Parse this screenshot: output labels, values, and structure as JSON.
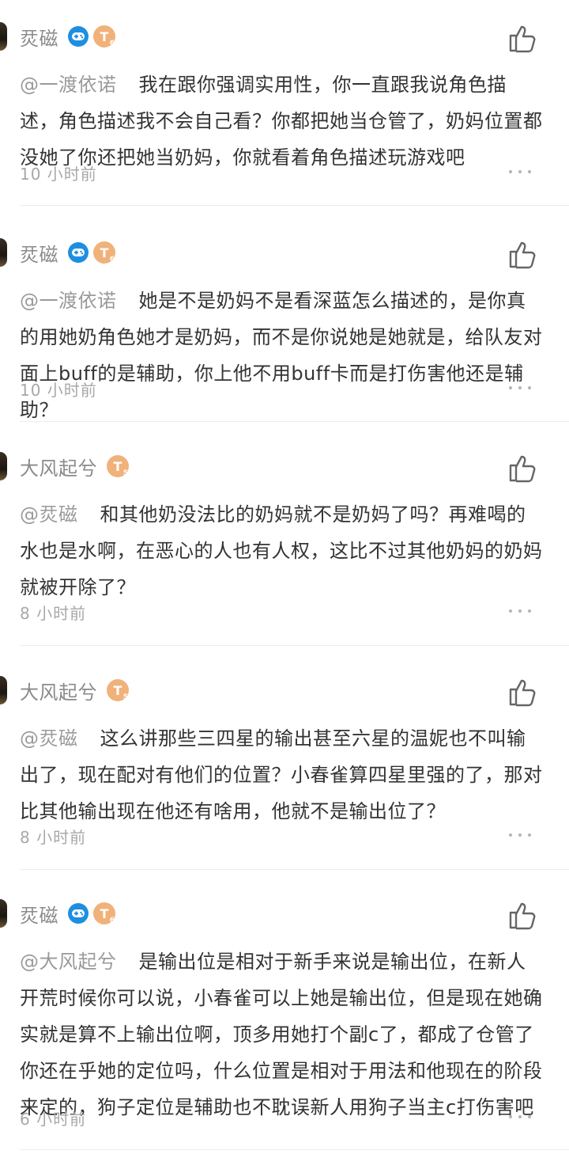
{
  "comments": [
    {
      "username": "烎磁",
      "badges": {
        "game": true,
        "level": "T",
        "level_sub": "6"
      },
      "mention": "@一渡依诺",
      "text": "我在跟你强调实用性，你一直跟我说角色描述，角色描述我不会自己看？你都把她当仓管了，奶妈位置都没她了你还把她当奶妈，你就看着角色描述玩游戏吧",
      "time": "10 小时前"
    },
    {
      "username": "烎磁",
      "badges": {
        "game": true,
        "level": "T",
        "level_sub": "6"
      },
      "mention": "@一渡依诺",
      "text": "她是不是奶妈不是看深蓝怎么描述的，是你真的用她奶角色她才是奶妈，而不是你说她是她就是，给队友对面上buff的是辅助，你上他不用buff卡而是打伤害他还是辅助？",
      "time": "10 小时前"
    },
    {
      "username": "大风起兮",
      "badges": {
        "game": false,
        "level": "T",
        "level_sub": "5"
      },
      "mention": "@烎磁",
      "text": "和其他奶没法比的奶妈就不是奶妈了吗？再难喝的水也是水啊，在恶心的人也有人权，这比不过其他奶妈的奶妈就被开除了？",
      "time": "8 小时前"
    },
    {
      "username": "大风起兮",
      "badges": {
        "game": false,
        "level": "T",
        "level_sub": "5"
      },
      "mention": "@烎磁",
      "text": "这么讲那些三四星的输出甚至六星的温妮也不叫输出了，现在配对有他们的位置？小春雀算四星里强的了，那对比其他输出现在他还有啥用，他就不是输出位了？",
      "time": "8 小时前"
    },
    {
      "username": "烎磁",
      "badges": {
        "game": true,
        "level": "T",
        "level_sub": "6"
      },
      "mention": "@大风起兮",
      "text": "是输出位是相对于新手来说是输出位，在新人开荒时候你可以说，小春雀可以上她是输出位，但是现在她确实就是算不上输出位啊，顶多用她打个副c了，都成了仓管了你还在乎她的定位吗，什么位置是相对于用法和他现在的阶段来定的，狗子定位是辅助也不耽误新人用狗子当主c打伤害吧",
      "time": "6 小时前"
    }
  ],
  "colors": {
    "game_badge": "#1e8fe0",
    "level_badge": "#f0b27a",
    "muted_text": "#8a8a8a"
  },
  "icons": [
    "gamepad-icon",
    "thumbs-up-icon",
    "more-dots-icon"
  ]
}
